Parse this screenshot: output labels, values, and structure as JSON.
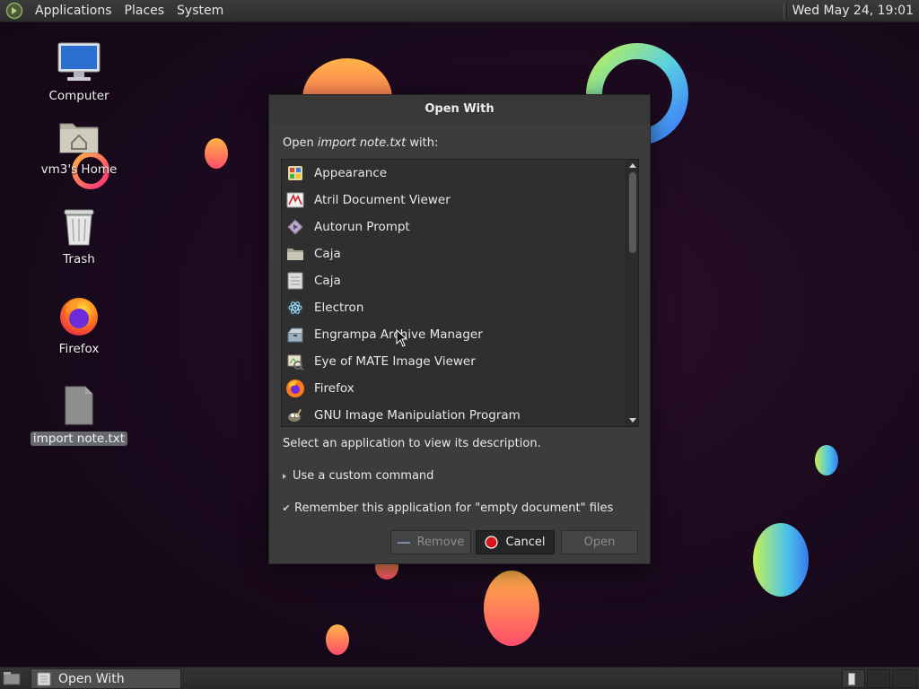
{
  "top_panel": {
    "menus": [
      "Applications",
      "Places",
      "System"
    ],
    "clock": "Wed May 24, 19:01"
  },
  "desktop": {
    "icons": [
      {
        "label": "Computer",
        "icon": "computer-icon"
      },
      {
        "label": "vm3's Home",
        "icon": "home-folder-icon"
      },
      {
        "label": "Trash",
        "icon": "trash-icon"
      },
      {
        "label": "Firefox",
        "icon": "firefox-icon"
      },
      {
        "label": "import note.txt",
        "icon": "text-file-icon",
        "selected": true
      }
    ]
  },
  "dialog": {
    "title": "Open With",
    "prompt_prefix": "Open ",
    "prompt_file": "import note.txt",
    "prompt_suffix": " with:",
    "apps": [
      {
        "name": "Appearance",
        "icon": "appearance-icon"
      },
      {
        "name": "Atril Document Viewer",
        "icon": "atril-icon"
      },
      {
        "name": "Autorun Prompt",
        "icon": "autorun-icon"
      },
      {
        "name": "Caja",
        "icon": "folder-icon"
      },
      {
        "name": "Caja",
        "icon": "file-manager-icon"
      },
      {
        "name": "Electron",
        "icon": "electron-icon"
      },
      {
        "name": "Engrampa Archive Manager",
        "icon": "archive-icon"
      },
      {
        "name": "Eye of MATE Image Viewer",
        "icon": "image-viewer-icon"
      },
      {
        "name": "Firefox",
        "icon": "firefox-icon"
      },
      {
        "name": "GNU Image Manipulation Program",
        "icon": "gimp-icon"
      }
    ],
    "description": "Select an application to view its description.",
    "custom_command": "Use a custom command",
    "remember_label": "Remember this application for \"empty document\" files",
    "remember_checked": true,
    "buttons": {
      "remove": "Remove",
      "cancel": "Cancel",
      "open": "Open"
    }
  },
  "taskbar": {
    "window_label": "Open With"
  },
  "colors": {
    "panel": "#2e2e2e",
    "dialog_bg": "#3c3c3c",
    "list_bg": "#2f2f2f",
    "cancel_icon": "#d9161e"
  }
}
